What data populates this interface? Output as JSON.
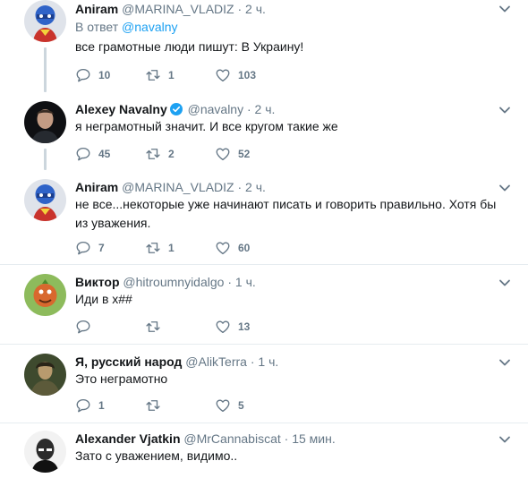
{
  "tweets": [
    {
      "name": "Aniram",
      "handle": "@MARINA_VLADIZ",
      "dot": "·",
      "time": "2 ч.",
      "reply_prefix": "В ответ",
      "reply_mention": "@navalny",
      "text": "все грамотные люди пишут:  В Украину!",
      "replies": "10",
      "retweets": "1",
      "likes": "103"
    },
    {
      "name": "Alexey Navalny",
      "verified": true,
      "handle": "@navalny",
      "dot": "·",
      "time": "2 ч.",
      "text": "я неграмотный значит. И все кругом такие же",
      "replies": "45",
      "retweets": "2",
      "likes": "52"
    },
    {
      "name": "Aniram",
      "handle": "@MARINA_VLADIZ",
      "dot": "·",
      "time": "2 ч.",
      "text": "не все...некоторые уже начинают писать и говорить правильно. Хотя бы из уважения.",
      "replies": "7",
      "retweets": "1",
      "likes": "60"
    },
    {
      "name": "Виктор",
      "handle": "@hitroumnyidalgo",
      "dot": "·",
      "time": "1 ч.",
      "text": "Иди в х##",
      "replies": "",
      "retweets": "",
      "likes": "13"
    },
    {
      "name": "Я, русский народ",
      "handle": "@AlikTerra",
      "dot": "·",
      "time": "1 ч.",
      "text": "Это неграмотно",
      "replies": "1",
      "retweets": "",
      "likes": "5"
    },
    {
      "name": "Alexander Vjatkin",
      "handle": "@MrCannabiscat",
      "dot": "·",
      "time": "15 мин.",
      "text": "Зато с уважением, видимо.."
    }
  ],
  "colors": {
    "name": "#14171a",
    "secondary": "#657786",
    "link": "#1da1f2",
    "divider": "#e6ecf0",
    "thread_line": "#ccd6dd"
  },
  "icons": [
    "reply-icon",
    "retweet-icon",
    "like-icon",
    "caret-down-icon",
    "verified-badge-icon"
  ]
}
